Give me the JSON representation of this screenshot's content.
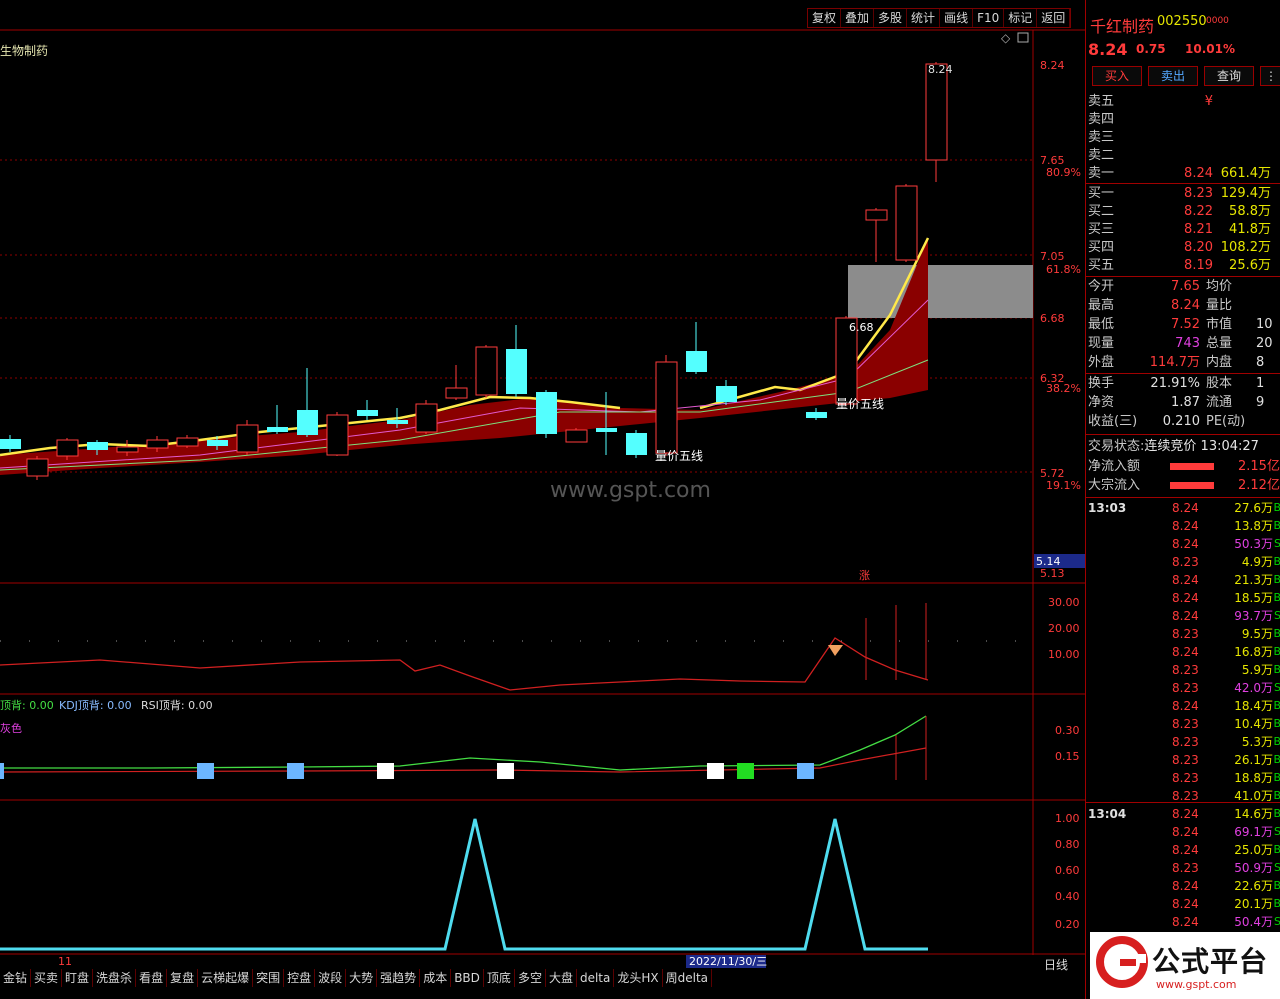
{
  "toolbar": {
    "buttons": [
      "复权",
      "叠加",
      "多股",
      "统计",
      "画线",
      "F10",
      "标记",
      "返回"
    ]
  },
  "stock": {
    "name": "千红制药",
    "code": "002550",
    "code_suffix": "0000",
    "price": "8.24",
    "change": "0.75",
    "change_pct": "10.01%",
    "chart_title_fragment": "生物制药"
  },
  "trade_buttons": {
    "buy": "买入",
    "sell": "卖出",
    "query": "查询"
  },
  "order_book": {
    "asks": [
      {
        "label": "卖五",
        "price": "¥",
        "vol": ""
      },
      {
        "label": "卖四",
        "price": "",
        "vol": ""
      },
      {
        "label": "卖三",
        "price": "",
        "vol": ""
      },
      {
        "label": "卖二",
        "price": "",
        "vol": ""
      },
      {
        "label": "卖一",
        "price": "8.24",
        "vol": "661.4万"
      }
    ],
    "bids": [
      {
        "label": "买一",
        "price": "8.23",
        "vol": "129.4万"
      },
      {
        "label": "买二",
        "price": "8.22",
        "vol": "58.8万"
      },
      {
        "label": "买三",
        "price": "8.21",
        "vol": "41.8万"
      },
      {
        "label": "买四",
        "price": "8.20",
        "vol": "108.2万"
      },
      {
        "label": "买五",
        "price": "8.19",
        "vol": "25.6万"
      }
    ]
  },
  "stats": [
    {
      "l1": "今开",
      "v1": "7.65",
      "l2": "均价",
      "v2": ""
    },
    {
      "l1": "最高",
      "v1": "8.24",
      "l2": "量比",
      "v2": ""
    },
    {
      "l1": "最低",
      "v1": "7.52",
      "l2": "市值",
      "v2": "10"
    },
    {
      "l1": "现量",
      "v1": "743",
      "l2": "总量",
      "v2": "20"
    },
    {
      "l1": "外盘",
      "v1": "114.7万",
      "l2": "内盘",
      "v2": "8"
    }
  ],
  "stats2": [
    {
      "l1": "换手",
      "v1": "21.91%",
      "l2": "股本",
      "v2": "1"
    },
    {
      "l1": "净资",
      "v1": "1.87",
      "l2": "流通",
      "v2": "9"
    },
    {
      "l1": "收益(三)",
      "v1": "0.210",
      "l2": "PE(动)",
      "v2": ""
    }
  ],
  "status": {
    "label": "交易状态:",
    "value": "连续竞价",
    "time": "13:04:27"
  },
  "flows": [
    {
      "label": "净流入额",
      "value": "2.15亿"
    },
    {
      "label": "大宗流入",
      "value": "2.12亿"
    }
  ],
  "ticks_1303": {
    "time": "13:03",
    "rows": [
      {
        "p": "8.24",
        "v": "27.6万",
        "m": false
      },
      {
        "p": "8.24",
        "v": "13.8万",
        "m": false
      },
      {
        "p": "8.24",
        "v": "50.3万",
        "m": true
      },
      {
        "p": "8.23",
        "v": "4.9万",
        "m": false
      },
      {
        "p": "8.24",
        "v": "21.3万",
        "m": false
      },
      {
        "p": "8.24",
        "v": "18.5万",
        "m": false
      },
      {
        "p": "8.24",
        "v": "93.7万",
        "m": true
      },
      {
        "p": "8.23",
        "v": "9.5万",
        "m": false
      },
      {
        "p": "8.24",
        "v": "16.8万",
        "m": false
      },
      {
        "p": "8.23",
        "v": "5.9万",
        "m": false
      },
      {
        "p": "8.23",
        "v": "42.0万",
        "m": true
      },
      {
        "p": "8.24",
        "v": "18.4万",
        "m": false
      },
      {
        "p": "8.23",
        "v": "10.4万",
        "m": false
      },
      {
        "p": "8.23",
        "v": "5.3万",
        "m": false
      },
      {
        "p": "8.23",
        "v": "26.1万",
        "m": false
      },
      {
        "p": "8.23",
        "v": "18.8万",
        "m": false
      },
      {
        "p": "8.23",
        "v": "41.0万",
        "m": false
      }
    ]
  },
  "ticks_1304": {
    "time": "13:04",
    "rows": [
      {
        "p": "8.24",
        "v": "14.6万",
        "m": false
      },
      {
        "p": "8.24",
        "v": "69.1万",
        "m": true
      },
      {
        "p": "8.24",
        "v": "25.0万",
        "m": false
      },
      {
        "p": "8.23",
        "v": "50.9万",
        "m": true
      },
      {
        "p": "8.24",
        "v": "22.6万",
        "m": false
      },
      {
        "p": "8.24",
        "v": "20.1万",
        "m": false
      },
      {
        "p": "8.24",
        "v": "50.4万",
        "m": true
      }
    ]
  },
  "price_axis": [
    "8.24",
    "7.65",
    "7.05",
    "6.68",
    "6.32",
    "5.72",
    "5.13"
  ],
  "pct_axis": [
    "80.9%",
    "61.8%",
    "38.2%",
    "19.1%"
  ],
  "axis_marker": "5.14",
  "chart_labels": {
    "high_label": "8.24",
    "box_label": "6.68",
    "ma_label_1": "量价五线",
    "ma_label_2": "量价五线",
    "watermark": "www.gspt.com",
    "up_marker": "涨",
    "date_marker": "2022/11/30/三",
    "left_day": "11",
    "period": "日线"
  },
  "panel2_axis": [
    "30.00",
    "20.00",
    "10.00"
  ],
  "panel3_legend": {
    "a": "顶背: 0.00",
    "b": "KDJ顶背: 0.00",
    "c": "RSI顶背: 0.00",
    "d": "灰色"
  },
  "panel3_axis": [
    "0.30",
    "0.15"
  ],
  "panel4_axis": [
    "1.00",
    "0.80",
    "0.60",
    "0.40",
    "0.20"
  ],
  "bottom_tabs": [
    "金钻",
    "买卖",
    "盯盘",
    "洗盘杀",
    "看盘",
    "复盘",
    "云梯起爆",
    "突围",
    "控盘",
    "波段",
    "大势",
    "强趋势",
    "成本",
    "BBD",
    "顶底",
    "多空",
    "大盘",
    "delta",
    "龙头HX",
    "周delta"
  ],
  "logo": {
    "text": "公式平台",
    "url": "www.gspt.com"
  },
  "colors": {
    "up": "#ff3b3b",
    "down": "#54ffff",
    "accent": "#e6e600",
    "grid": "#8b0000"
  }
}
